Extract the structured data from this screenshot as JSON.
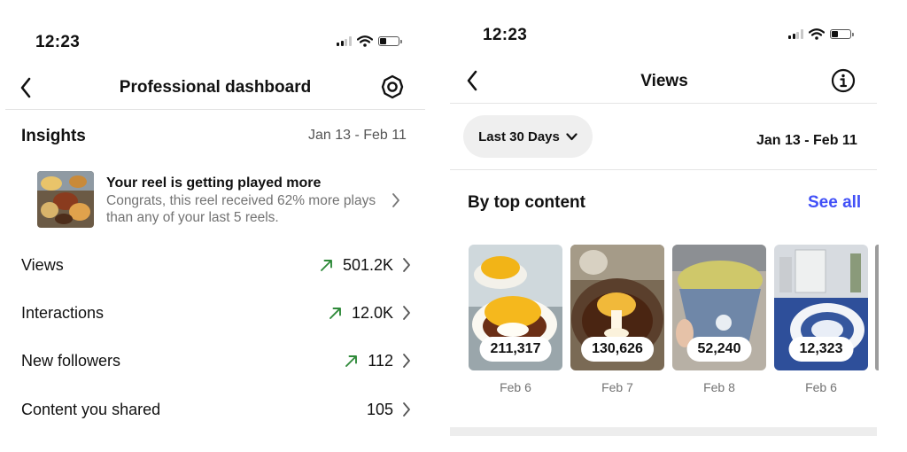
{
  "left_screen": {
    "status_time": "12:23",
    "nav_title": "Professional dashboard",
    "insights": {
      "title": "Insights",
      "date_range": "Jan 13 - Feb 11"
    },
    "reel_card": {
      "title": "Your reel is getting played more",
      "body": "Congrats, this reel received 62% more plays than any of your last 5 reels."
    },
    "metrics": [
      {
        "label": "Views",
        "value": "501.2K",
        "trend": "up"
      },
      {
        "label": "Interactions",
        "value": "12.0K",
        "trend": "up"
      },
      {
        "label": "New followers",
        "value": "112",
        "trend": "up"
      },
      {
        "label": "Content you shared",
        "value": "105",
        "trend": "none"
      }
    ]
  },
  "right_screen": {
    "status_time": "12:23",
    "nav_title": "Views",
    "filter_label": "Last 30 Days",
    "date_range": "Jan 13 - Feb 11",
    "section_title": "By top content",
    "see_all_label": "See all",
    "content_items": [
      {
        "views": "211,317",
        "date": "Feb 6"
      },
      {
        "views": "130,626",
        "date": "Feb 7"
      },
      {
        "views": "52,240",
        "date": "Feb 8"
      },
      {
        "views": "12,323",
        "date": "Feb 6"
      }
    ]
  },
  "colors": {
    "accent_link": "#4150f7",
    "trend_up": "#2f8a3a",
    "muted_text": "#737373",
    "pill_bg": "#efefef"
  },
  "icons": {
    "back": "chevron-left-icon",
    "settings": "gear-icon",
    "info": "info-icon",
    "trend_up": "trend-arrow-up-icon",
    "row_chevron": "chevron-right-icon",
    "dropdown": "chevron-down-icon"
  }
}
